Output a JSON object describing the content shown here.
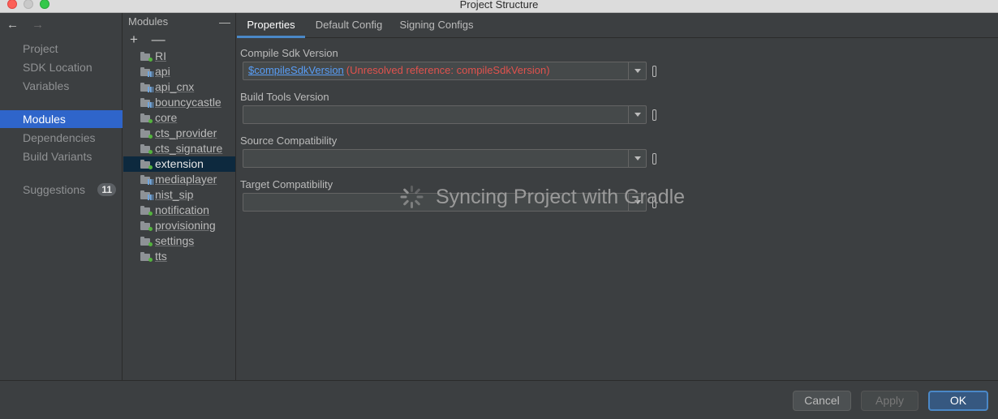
{
  "window": {
    "title": "Project Structure"
  },
  "nav": {
    "back_icon": "←",
    "forward_icon": "→",
    "items": [
      {
        "label": "Project"
      },
      {
        "label": "SDK Location"
      },
      {
        "label": "Variables"
      },
      {
        "label": "Modules",
        "selected": true
      },
      {
        "label": "Dependencies"
      },
      {
        "label": "Build Variants"
      },
      {
        "label": "Suggestions",
        "badge": "11"
      }
    ]
  },
  "modules": {
    "header": "Modules",
    "collapse_icon": "—",
    "add_icon": "+",
    "remove_icon": "—",
    "items": [
      {
        "label": "RI",
        "icon": "android-module"
      },
      {
        "label": "api",
        "icon": "library-module"
      },
      {
        "label": "api_cnx",
        "icon": "library-module"
      },
      {
        "label": "bouncycastle",
        "icon": "library-module"
      },
      {
        "label": "core",
        "icon": "android-module"
      },
      {
        "label": "cts_provider",
        "icon": "android-module"
      },
      {
        "label": "cts_signature",
        "icon": "android-module"
      },
      {
        "label": "extension",
        "icon": "android-module",
        "selected": true
      },
      {
        "label": "mediaplayer",
        "icon": "library-module"
      },
      {
        "label": "nist_sip",
        "icon": "library-module"
      },
      {
        "label": "notification",
        "icon": "android-module"
      },
      {
        "label": "provisioning",
        "icon": "android-module"
      },
      {
        "label": "settings",
        "icon": "android-module"
      },
      {
        "label": "tts",
        "icon": "android-module"
      }
    ]
  },
  "tabs": [
    {
      "label": "Properties",
      "active": true
    },
    {
      "label": "Default Config"
    },
    {
      "label": "Signing Configs"
    }
  ],
  "properties": {
    "compile_sdk": {
      "label": "Compile Sdk Version",
      "ref": "$compileSdkVersion",
      "error": "(Unresolved reference: compileSdkVersion)"
    },
    "build_tools": {
      "label": "Build Tools Version",
      "value": ""
    },
    "source_compat": {
      "label": "Source Compatibility",
      "value": ""
    },
    "target_compat": {
      "label": "Target Compatibility",
      "value": ""
    }
  },
  "sync": {
    "text": "Syncing Project with Gradle"
  },
  "buttons": {
    "cancel": "Cancel",
    "apply": "Apply",
    "ok": "OK"
  },
  "colors": {
    "accent": "#2f65ca",
    "error": "#e0524d",
    "link": "#589df6",
    "selected_row": "#0d293e"
  }
}
